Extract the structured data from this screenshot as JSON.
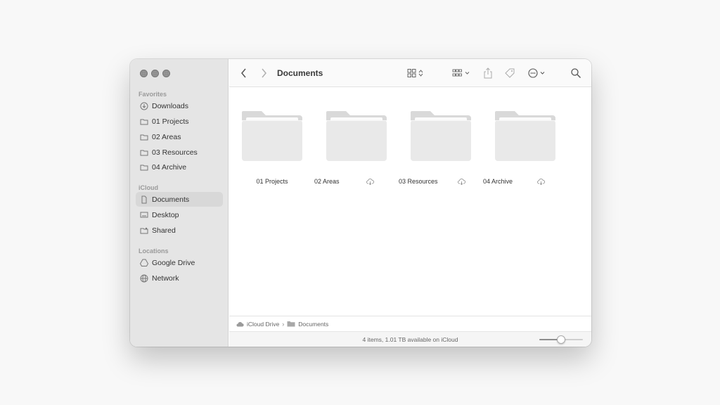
{
  "window": {
    "title": "Documents"
  },
  "sidebar": {
    "sections": [
      {
        "title": "Favorites",
        "items": [
          {
            "label": "Downloads",
            "icon": "download-icon"
          },
          {
            "label": "01 Projects",
            "icon": "folder-icon"
          },
          {
            "label": "02 Areas",
            "icon": "folder-icon"
          },
          {
            "label": "03 Resources",
            "icon": "folder-icon"
          },
          {
            "label": "04 Archive",
            "icon": "folder-icon"
          }
        ]
      },
      {
        "title": "iCloud",
        "items": [
          {
            "label": "Documents",
            "icon": "document-icon",
            "selected": true
          },
          {
            "label": "Desktop",
            "icon": "desktop-icon"
          },
          {
            "label": "Shared",
            "icon": "shared-folder-icon"
          }
        ]
      },
      {
        "title": "Locations",
        "items": [
          {
            "label": "Google Drive",
            "icon": "google-drive-icon"
          },
          {
            "label": "Network",
            "icon": "globe-icon"
          }
        ]
      }
    ]
  },
  "folders": [
    {
      "name": "01 Projects",
      "cloud": false
    },
    {
      "name": "02 Areas",
      "cloud": true
    },
    {
      "name": "03 Resources",
      "cloud": true
    },
    {
      "name": "04 Archive",
      "cloud": true
    }
  ],
  "pathbar": {
    "items": [
      "iCloud Drive",
      "Documents"
    ]
  },
  "status": {
    "text": "4 items, 1.01 TB available on iCloud"
  },
  "zoom": {
    "level": 0.5
  }
}
